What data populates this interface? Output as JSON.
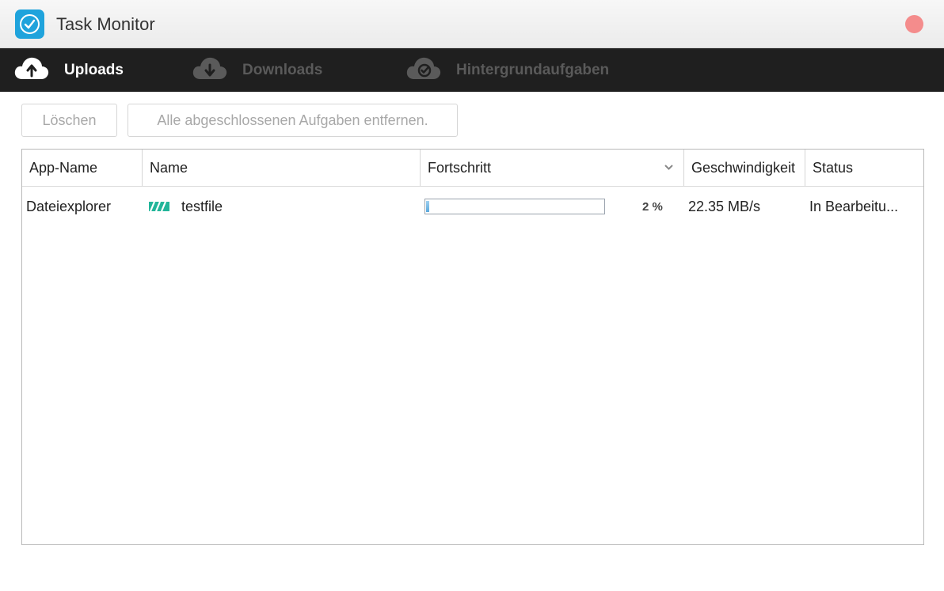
{
  "window": {
    "title": "Task Monitor"
  },
  "tabs": [
    {
      "label": "Uploads",
      "icon": "cloud-upload-icon",
      "active": true
    },
    {
      "label": "Downloads",
      "icon": "cloud-download-icon",
      "active": false
    },
    {
      "label": "Hintergrundaufgaben",
      "icon": "cloud-check-icon",
      "active": false
    }
  ],
  "toolbar": {
    "clear_label": "Löschen",
    "remove_completed_label": "Alle abgeschlossenen Aufgaben entfernen."
  },
  "table": {
    "columns": [
      "App-Name",
      "Name",
      "Fortschritt",
      "Geschwindigkeit",
      "Status"
    ],
    "rows": [
      {
        "app": "Dateiexplorer",
        "name": "testfile",
        "file_icon": "upload-stripes-icon",
        "progress_percent": 2,
        "progress_label": "2 %",
        "speed": "22.35 MB/s",
        "status": "In Bearbeitu..."
      }
    ]
  },
  "colors": {
    "accent": "#1fa3dc",
    "tabbar_bg": "#1f1f1f",
    "close_button": "#f48c8c",
    "progress_fill": "#5aa8dc",
    "file_icon": "#22b59a"
  }
}
